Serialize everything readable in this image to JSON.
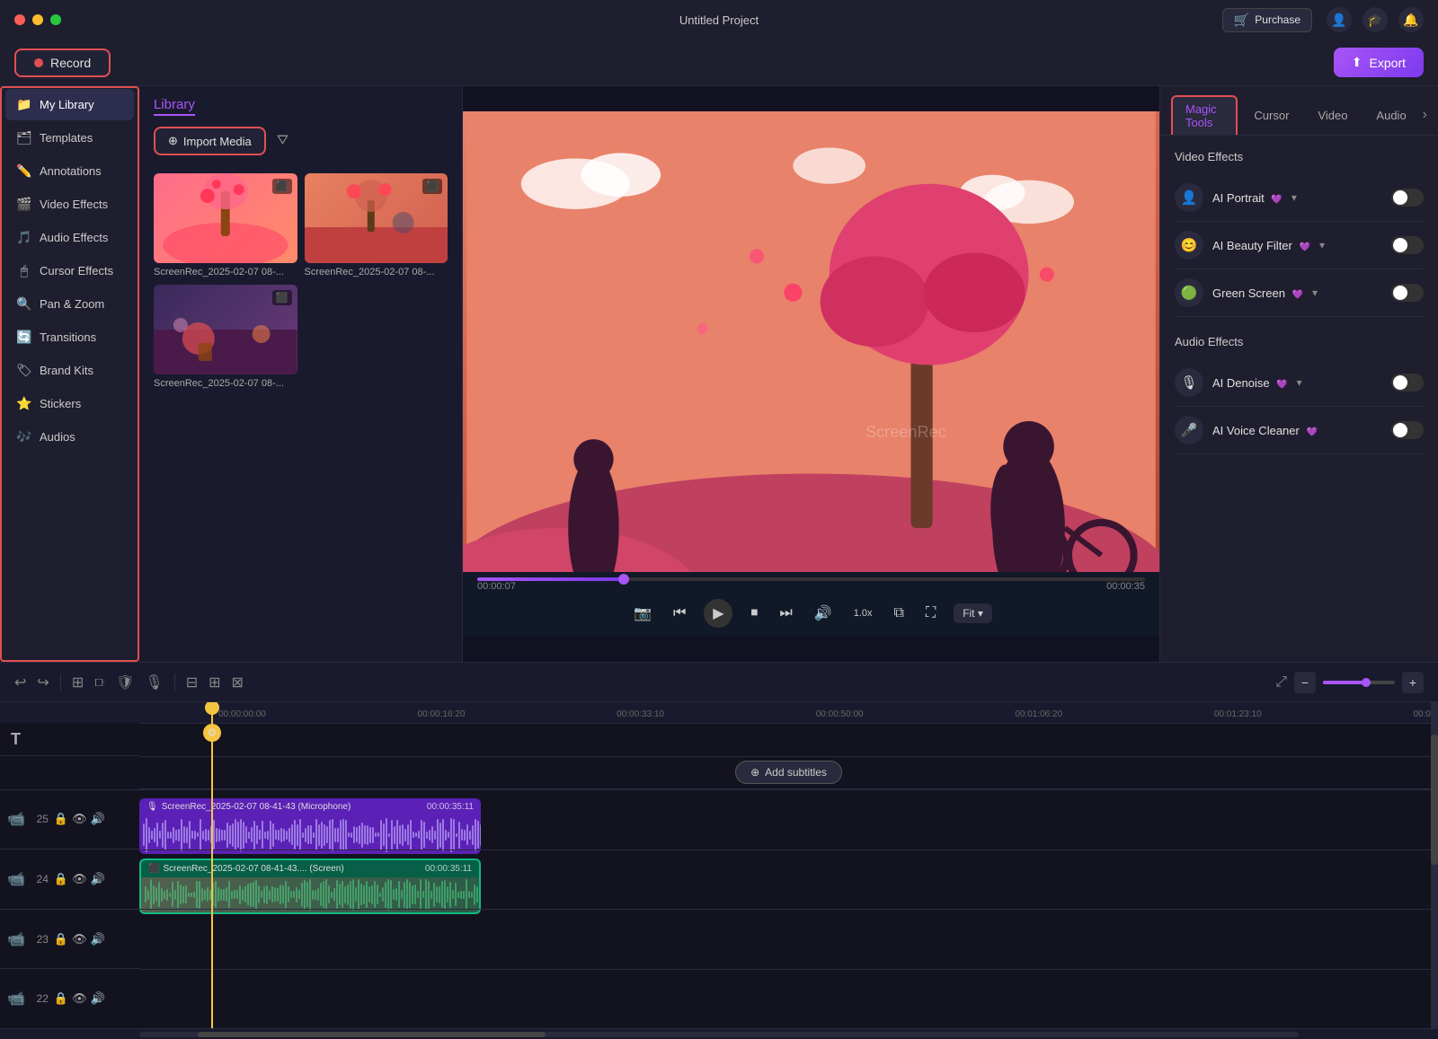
{
  "titlebar": {
    "title": "Untitled Project",
    "purchase_label": "Purchase",
    "dots": [
      "red",
      "yellow",
      "green"
    ]
  },
  "toolbar": {
    "record_label": "Record",
    "export_label": "Export"
  },
  "sidebar": {
    "items": [
      {
        "id": "my-library",
        "label": "My Library",
        "icon": "📁",
        "active": true
      },
      {
        "id": "templates",
        "label": "Templates",
        "icon": "🗂"
      },
      {
        "id": "annotations",
        "label": "Annotations",
        "icon": "✏️"
      },
      {
        "id": "video-effects",
        "label": "Video Effects",
        "icon": "🎬"
      },
      {
        "id": "audio-effects",
        "label": "Audio Effects",
        "icon": "🎵"
      },
      {
        "id": "cursor-effects",
        "label": "Cursor Effects",
        "icon": "🖱"
      },
      {
        "id": "pan-zoom",
        "label": "Pan & Zoom",
        "icon": "🔍"
      },
      {
        "id": "transitions",
        "label": "Transitions",
        "icon": "🔄"
      },
      {
        "id": "brand-kits",
        "label": "Brand Kits",
        "icon": "🏷"
      },
      {
        "id": "stickers",
        "label": "Stickers",
        "icon": "⭐"
      },
      {
        "id": "audios",
        "label": "Audios",
        "icon": "🎶"
      }
    ]
  },
  "library": {
    "tab_label": "Library",
    "import_label": "Import Media",
    "media_items": [
      {
        "label": "ScreenRec_2025-02-07 08-...",
        "id": 1
      },
      {
        "label": "ScreenRec_2025-02-07 08-...",
        "id": 2
      },
      {
        "label": "ScreenRec_2025-02-07 08-...",
        "id": 3
      }
    ]
  },
  "preview": {
    "current_time": "00:00:07",
    "total_time": "00:00:35",
    "fit_label": "Fit",
    "progress_pct": 22
  },
  "right_panel": {
    "tabs": [
      {
        "id": "magic-tools",
        "label": "Magic Tools",
        "active": true
      },
      {
        "id": "cursor",
        "label": "Cursor"
      },
      {
        "id": "video",
        "label": "Video"
      },
      {
        "id": "audio",
        "label": "Audio"
      }
    ],
    "video_effects_title": "Video Effects",
    "audio_effects_title": "Audio Effects",
    "effects": [
      {
        "id": "ai-portrait",
        "name": "AI Portrait",
        "icon": "👤",
        "badge": "💜",
        "has_dropdown": true,
        "enabled": false
      },
      {
        "id": "ai-beauty-filter",
        "name": "AI Beauty Filter",
        "icon": "😊",
        "badge": "💜",
        "has_dropdown": true,
        "enabled": false
      },
      {
        "id": "green-screen",
        "name": "Green Screen",
        "icon": "🟢",
        "badge": "💜",
        "has_dropdown": true,
        "enabled": false
      }
    ],
    "audio_effects": [
      {
        "id": "ai-denoise",
        "name": "AI Denoise",
        "icon": "🎙",
        "badge": "💜",
        "has_dropdown": true,
        "enabled": false
      },
      {
        "id": "ai-voice-cleaner",
        "name": "AI Voice Cleaner",
        "icon": "🎤",
        "badge": "💜",
        "has_dropdown": false,
        "enabled": false
      }
    ]
  },
  "timeline": {
    "subtitle_btn": "Add subtitles",
    "ruler_marks": [
      "00:00:00:00",
      "00:00:16:20",
      "00:00:33:10",
      "00:00:50:00",
      "00:01:06:20",
      "00:01:23:10",
      "00:0"
    ],
    "tracks": [
      {
        "num": 25,
        "type": "audio",
        "clip_label": "ScreenRec_2025-02-07 08-41-43 (Microphone)",
        "clip_time": "00:00:35:11",
        "bg": "#5b21b6"
      },
      {
        "num": 24,
        "type": "video",
        "clip_label": "ScreenRec_2025-02-07 08-41-43.... (Screen)",
        "clip_time": "00:00:35:11",
        "bg": "#065f46"
      },
      {
        "num": 23,
        "type": "empty",
        "clip_label": "",
        "clip_time": ""
      },
      {
        "num": 22,
        "type": "empty",
        "clip_label": "",
        "clip_time": ""
      }
    ]
  }
}
